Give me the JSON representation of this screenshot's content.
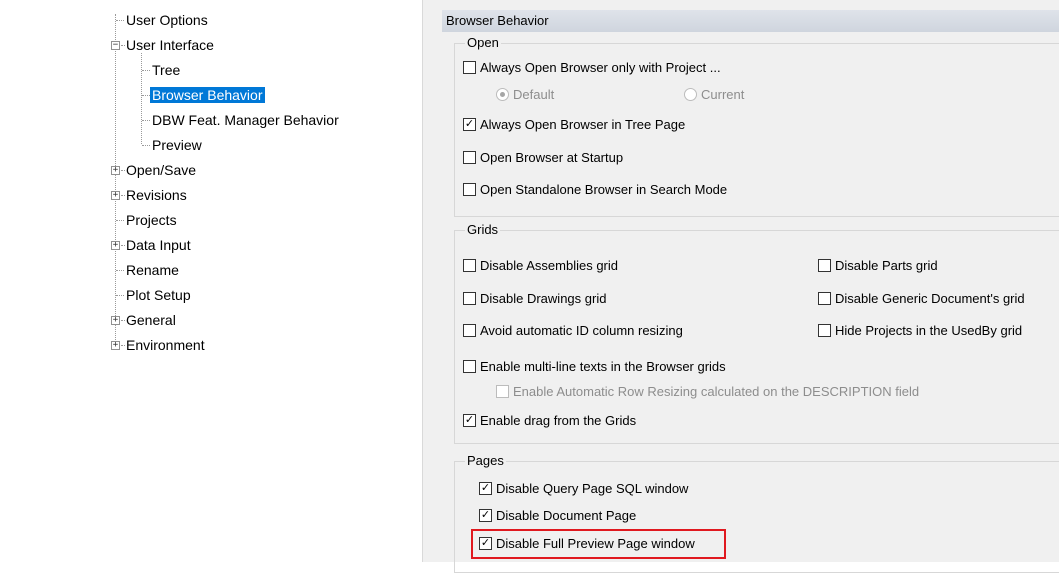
{
  "tree": {
    "items": [
      {
        "label": "User Options"
      },
      {
        "label": "User Interface"
      },
      {
        "label": "Tree"
      },
      {
        "label": "Browser Behavior"
      },
      {
        "label": "DBW Feat. Manager Behavior"
      },
      {
        "label": "Preview"
      },
      {
        "label": "Open/Save"
      },
      {
        "label": "Revisions"
      },
      {
        "label": "Projects"
      },
      {
        "label": "Data Input"
      },
      {
        "label": "Rename"
      },
      {
        "label": "Plot Setup"
      },
      {
        "label": "General"
      },
      {
        "label": "Environment"
      }
    ],
    "selected": "Browser Behavior",
    "expand_collapsed": "+",
    "expand_expanded": "−"
  },
  "panel": {
    "title": "Browser Behavior",
    "open": {
      "title": "Open",
      "always_open_with_project": {
        "label": "Always Open Browser only with Project ...",
        "checked": false
      },
      "radio_default": {
        "label": "Default",
        "selected": true
      },
      "radio_current": {
        "label": "Current",
        "selected": false
      },
      "always_open_tree_page": {
        "label": "Always Open Browser in Tree Page",
        "checked": true
      },
      "open_at_startup": {
        "label": "Open Browser at Startup",
        "checked": false
      },
      "standalone_search": {
        "label": "Open Standalone Browser in Search Mode",
        "checked": false
      }
    },
    "grids": {
      "title": "Grids",
      "disable_assemblies": {
        "label": "Disable Assemblies grid",
        "checked": false
      },
      "disable_parts": {
        "label": "Disable Parts grid",
        "checked": false
      },
      "disable_drawings": {
        "label": "Disable Drawings grid",
        "checked": false
      },
      "disable_generic": {
        "label": "Disable Generic Document's grid",
        "checked": false
      },
      "avoid_id_resize": {
        "label": "Avoid automatic ID column resizing",
        "checked": false
      },
      "hide_projects_usedby": {
        "label": "Hide Projects in the UsedBy grid",
        "checked": false
      },
      "multiline_texts": {
        "label": "Enable multi-line texts in the Browser grids",
        "checked": false
      },
      "auto_row_resize": {
        "label": "Enable Automatic Row Resizing calculated on the DESCRIPTION field",
        "checked": false
      },
      "drag_from_grids": {
        "label": "Enable drag from the Grids",
        "checked": true
      }
    },
    "pages": {
      "title": "Pages",
      "disable_query_sql": {
        "label": "Disable Query Page SQL window",
        "checked": true
      },
      "disable_document_page": {
        "label": "Disable Document Page",
        "checked": true
      },
      "disable_full_preview": {
        "label": "Disable Full Preview Page window",
        "checked": true
      }
    },
    "check_mark": "✓"
  },
  "colors": {
    "selection": "#0078d7",
    "highlight_border": "#e0191f",
    "panel_bg": "#f0f0f0"
  }
}
